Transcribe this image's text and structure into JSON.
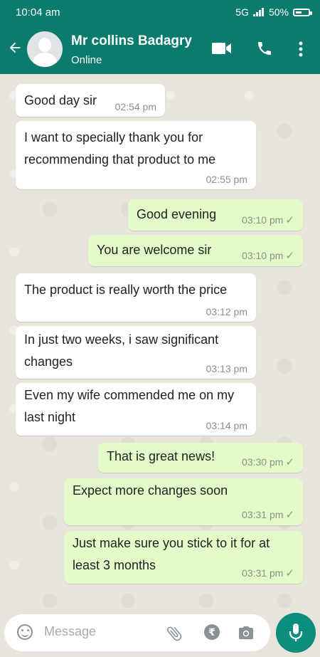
{
  "status_bar": {
    "time": "10:04 am",
    "network": "5G",
    "battery": "50%"
  },
  "header": {
    "contact_name": "Mr collins Badagry",
    "status": "Online"
  },
  "messages": [
    {
      "dir": "in",
      "text": "Good day sir",
      "time": "02:54 pm"
    },
    {
      "dir": "in",
      "text": "I want to specially thank you for recommending that product to me",
      "time": "02:55 pm"
    },
    {
      "dir": "out",
      "text": "Good evening",
      "time": "03:10 pm"
    },
    {
      "dir": "out",
      "text": "You are welcome sir",
      "time": "03:10 pm"
    },
    {
      "dir": "in",
      "text": "The product is really worth the price",
      "time": "03:12 pm"
    },
    {
      "dir": "in",
      "text": "In just two weeks, i saw significant changes",
      "time": "03:13 pm"
    },
    {
      "dir": "in",
      "text": "Even my wife commended me on my last night",
      "time": "03:14 pm"
    },
    {
      "dir": "out",
      "text": "That is great news!",
      "time": "03:30 pm"
    },
    {
      "dir": "out",
      "text": "Expect more changes soon",
      "time": "03:31 pm"
    },
    {
      "dir": "out",
      "text": "Just make sure you stick to it for at least 3 months",
      "time": "03:31 pm"
    }
  ],
  "input": {
    "placeholder": "Message"
  },
  "icons": [
    "back-arrow-icon",
    "video-call-icon",
    "phone-icon",
    "more-vert-icon",
    "emoji-icon",
    "attach-icon",
    "rupee-icon",
    "camera-icon",
    "mic-icon"
  ],
  "colors": {
    "header": "#0b7b6e",
    "outgoing_bubble": "#e3fbc9",
    "incoming_bubble": "#ffffff",
    "mic_button": "#0b8e7d"
  }
}
